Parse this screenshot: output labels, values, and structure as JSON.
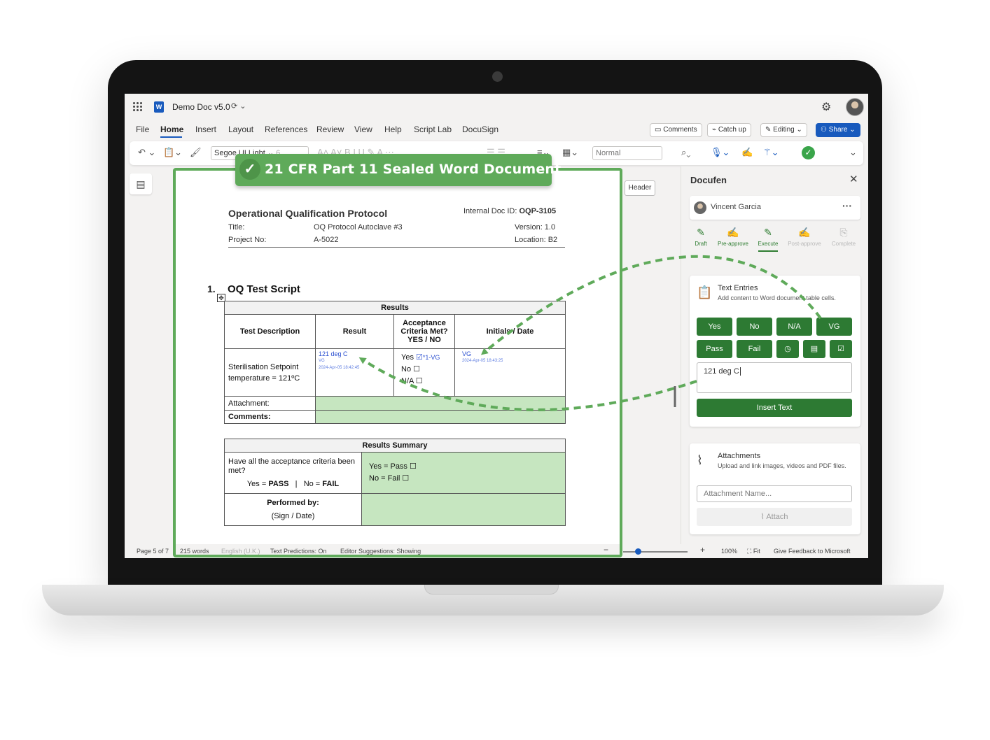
{
  "app": {
    "doc_title": "Demo Doc v5.0",
    "menu": [
      "File",
      "Home",
      "Insert",
      "Layout",
      "References",
      "Review",
      "View",
      "Help",
      "Script Lab",
      "DocuSign"
    ],
    "ribbon_buttons": {
      "comments": "Comments",
      "catchup": "Catch up",
      "editing": "Editing",
      "share": "Share"
    },
    "toolbar": {
      "font": "Segoe UI Light",
      "font_size": "6",
      "style": "Normal"
    }
  },
  "overlay": {
    "badge_text": "21 CFR Part 11 Sealed Word Document",
    "check": "✓"
  },
  "document": {
    "header_button": "Header",
    "protocol_title": "Operational Qualification Protocol",
    "internal_id_label": "Internal Doc ID:",
    "internal_id_value": "OQP-3105",
    "title_label": "Title:",
    "title_value": "OQ Protocol Autoclave #3",
    "version": "Version: 1.0",
    "project_label": "Project No:",
    "project_value": "A-5022",
    "location": "Location: B2",
    "section_number": "1.",
    "section_title": "OQ Test Script",
    "results_table": {
      "caption": "Results",
      "col_test": "Test Description",
      "col_result": "Result",
      "col_accept": "Acceptance Criteria Met? YES / NO",
      "col_initials": "Initials / Date",
      "test_desc": "Sterilisation Setpoint temperature = 121ºC",
      "result_value": "121 deg C",
      "result_initials": "VG",
      "result_timestamp": "2024-Apr-05 18:42:45",
      "yes_label": "Yes",
      "yes_mark": "☑",
      "yes_note": "*1-VG",
      "no_label": "No ☐",
      "na_label": "N/A ☐",
      "initials_value": "VG",
      "initials_timestamp": "2024-Apr-05 18:43:25",
      "attachment_label": "Attachment:",
      "comments_label": "Comments:"
    },
    "summary_table": {
      "caption": "Results Summary",
      "question": "Have all the acceptance criteria been met?",
      "legend_yes_prefix": "Yes = ",
      "legend_yes": "PASS",
      "legend_sep": "|",
      "legend_no_prefix": "No = ",
      "legend_no": "FAIL",
      "yes_pass": "Yes = Pass ☐",
      "no_fail": "No = Fail ☐",
      "performed_by": "Performed by:",
      "sign_date": "(Sign / Date)"
    }
  },
  "statusbar": {
    "page": "Page 5 of 7",
    "words": "215 words",
    "language": "English (U.K.)",
    "predictions": "Text Predictions: On",
    "editor": "Editor Suggestions: Showing",
    "zoom": "100%",
    "fit": "Fit",
    "feedback": "Give Feedback to Microsoft"
  },
  "panel": {
    "title": "Docufen",
    "user": "Vincent Garcia",
    "steps": [
      {
        "label": "Draft",
        "icon": "draft-icon",
        "active": true
      },
      {
        "label": "Pre-approve",
        "icon": "pre-approve-icon",
        "active": true
      },
      {
        "label": "Execute",
        "icon": "execute-icon",
        "active": true
      },
      {
        "label": "Post-approve",
        "icon": "post-approve-icon",
        "active": false
      },
      {
        "label": "Complete",
        "icon": "complete-icon",
        "active": false
      }
    ],
    "text_entries": {
      "title": "Text Entries",
      "subtitle": "Add content to Word document table cells.",
      "buttons_row1": [
        "Yes",
        "No",
        "N/A",
        "VG"
      ],
      "buttons_row2": [
        "Pass",
        "Fail"
      ],
      "input_value": "121 deg C",
      "insert_label": "Insert Text"
    },
    "attachments": {
      "title": "Attachments",
      "subtitle": "Upload and link images, videos and PDF files.",
      "placeholder": "Attachment Name...",
      "attach_label": "Attach"
    },
    "accent": "#2d7a33"
  }
}
